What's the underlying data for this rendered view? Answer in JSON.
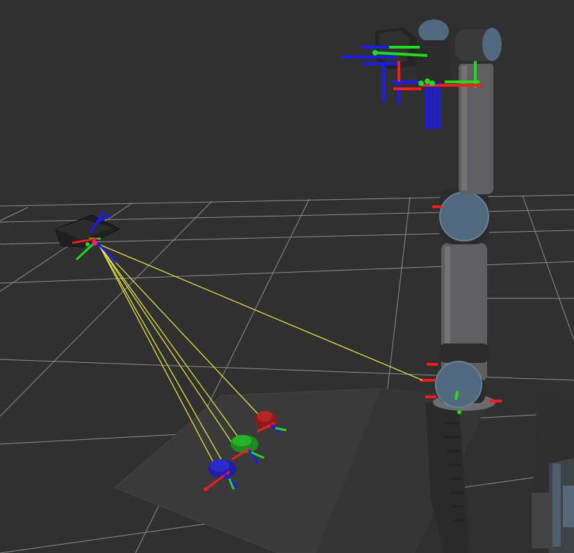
{
  "view": {
    "background_color": "#303030",
    "grid_color": "#a0a0a4",
    "ray_color": "#e6e63c",
    "axis_colors": {
      "x": "#ff1a1a",
      "y": "#1adf1a",
      "z": "#1a1aff"
    },
    "robot_joint_color": "#50697f",
    "robot_link_color": "#5f5f61"
  },
  "scene_objects": [
    {
      "name": "ground-grid"
    },
    {
      "name": "workbench-surface"
    },
    {
      "name": "right-side-shelf"
    },
    {
      "name": "robot-arm"
    },
    {
      "name": "overhead-camera"
    },
    {
      "name": "detected-marker-blue"
    },
    {
      "name": "detected-marker-green"
    },
    {
      "name": "detected-marker-red"
    },
    {
      "name": "camera-detection-rays"
    },
    {
      "name": "tool-flange-frames"
    }
  ]
}
